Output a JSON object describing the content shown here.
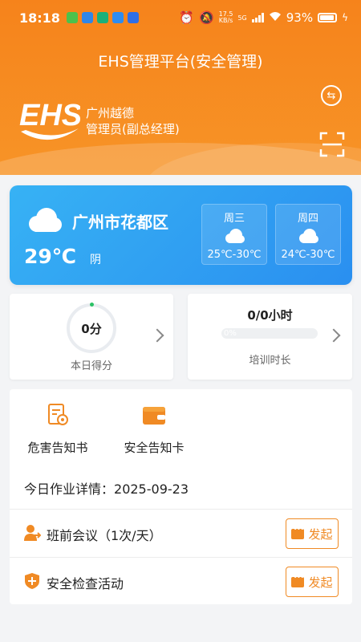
{
  "status_bar": {
    "time": "18:18",
    "net_speed_value": "17.5",
    "net_speed_unit": "KB/s",
    "network": "5G",
    "battery": "93%"
  },
  "header": {
    "title": "EHS管理平台(安全管理)",
    "org_name": "广州越德",
    "user_role": "管理员(副总经理)",
    "logo_text": "EHS",
    "switch_icon": "switch-arrows-icon",
    "scan_icon": "scan-icon"
  },
  "weather": {
    "city": "广州市花都区",
    "temperature": "29℃",
    "condition": "阴",
    "forecast": [
      {
        "day": "周三",
        "range": "25℃-30℃",
        "icon": "cloud-icon"
      },
      {
        "day": "周四",
        "range": "24℃-30℃",
        "icon": "cloud-icon"
      }
    ]
  },
  "score": {
    "value": "0分",
    "label": "本日得分"
  },
  "training": {
    "hours": "0/0小时",
    "progress_text": "0%",
    "progress_fraction": 0,
    "label": "培训时长"
  },
  "quick_actions": [
    {
      "label": "危害告知书",
      "icon": "hazard-notice-icon"
    },
    {
      "label": "安全告知卡",
      "icon": "safety-card-icon"
    }
  ],
  "today": {
    "title_prefix": "今日作业详情：",
    "date": "2025-09-23"
  },
  "tasks": [
    {
      "label": "班前会议（1次/天）",
      "button": "发起",
      "icon": "meeting-person-icon"
    },
    {
      "label": "安全检查活动",
      "button": "发起",
      "icon": "shield-icon"
    }
  ],
  "colors": {
    "brand_orange": "#f6831b",
    "weather_blue": "#2a8ff0",
    "success_green": "#2bc265"
  }
}
